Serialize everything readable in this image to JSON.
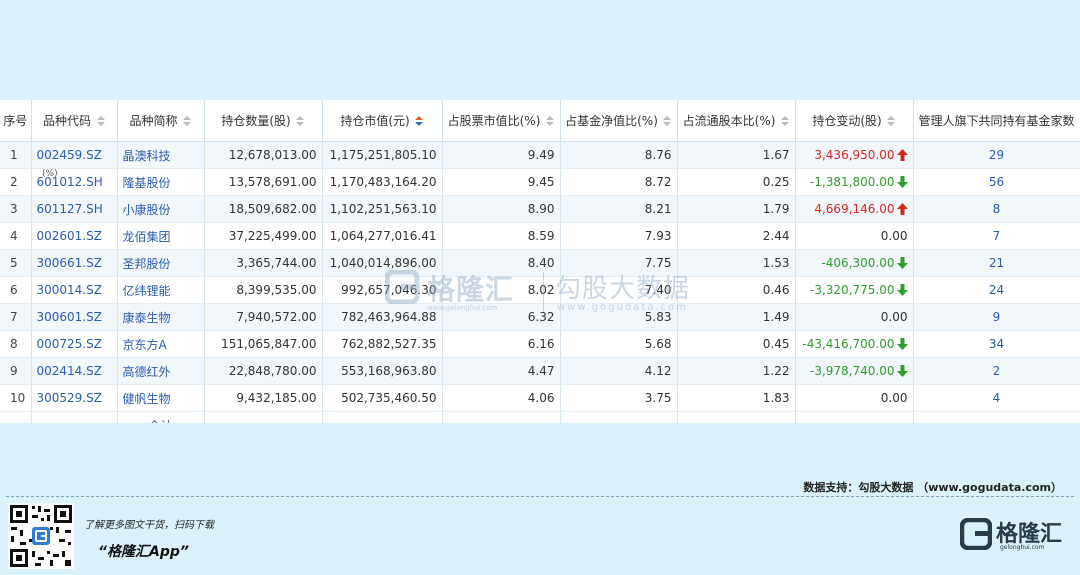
{
  "table": {
    "columns": [
      {
        "label": "序号",
        "sortable": false
      },
      {
        "label": "品种代码",
        "sortable": true
      },
      {
        "label": "品种简称",
        "sortable": true
      },
      {
        "label": "持仓数量(股)",
        "sortable": true
      },
      {
        "label": "持仓市值(元)",
        "sortable": true,
        "active": true
      },
      {
        "label": "占股票市值比(%)",
        "sortable": true
      },
      {
        "label": "占基金净值比(%)",
        "sortable": true
      },
      {
        "label": "占流通股本比(%)",
        "sortable": true
      },
      {
        "label": "持仓变动(股)",
        "sortable": true
      },
      {
        "label": "管理人旗下共同持有基金家数",
        "sortable": false
      }
    ],
    "rows": [
      {
        "idx": "1",
        "code": "002459.SZ",
        "name": "晶澳科技",
        "qty": "12,678,013.00",
        "mv": "1,175,251,805.10",
        "stock_pct": "9.49",
        "nav_pct": "8.76",
        "float_pct": "1.67",
        "change": "3,436,950.00",
        "dir": "up",
        "funds": "29"
      },
      {
        "idx": "2",
        "code": "601012.SH",
        "name": "隆基股份",
        "qty": "13,578,691.00",
        "mv": "1,170,483,164.20",
        "stock_pct": "9.45",
        "nav_pct": "8.72",
        "float_pct": "0.25",
        "change": "-1,381,800.00",
        "dir": "down",
        "funds": "56"
      },
      {
        "idx": "3",
        "code": "601127.SH",
        "name": "小康股份",
        "qty": "18,509,682.00",
        "mv": "1,102,251,563.10",
        "stock_pct": "8.90",
        "nav_pct": "8.21",
        "float_pct": "1.79",
        "change": "4,669,146.00",
        "dir": "up",
        "funds": "8"
      },
      {
        "idx": "4",
        "code": "002601.SZ",
        "name": "龙佰集团",
        "qty": "37,225,499.00",
        "mv": "1,064,277,016.41",
        "stock_pct": "8.59",
        "nav_pct": "7.93",
        "float_pct": "2.44",
        "change": "0.00",
        "dir": "none",
        "funds": "7"
      },
      {
        "idx": "5",
        "code": "300661.SZ",
        "name": "圣邦股份",
        "qty": "3,365,744.00",
        "mv": "1,040,014,896.00",
        "stock_pct": "8.40",
        "nav_pct": "7.75",
        "float_pct": "1.53",
        "change": "-406,300.00",
        "dir": "down",
        "funds": "21"
      },
      {
        "idx": "6",
        "code": "300014.SZ",
        "name": "亿纬锂能",
        "qty": "8,399,535.00",
        "mv": "992,657,046.30",
        "stock_pct": "8.02",
        "nav_pct": "7.40",
        "float_pct": "0.46",
        "change": "-3,320,775.00",
        "dir": "down",
        "funds": "24"
      },
      {
        "idx": "7",
        "code": "300601.SZ",
        "name": "康泰生物",
        "qty": "7,940,572.00",
        "mv": "782,463,964.88",
        "stock_pct": "6.32",
        "nav_pct": "5.83",
        "float_pct": "1.49",
        "change": "0.00",
        "dir": "none",
        "funds": "9"
      },
      {
        "idx": "8",
        "code": "000725.SZ",
        "name": "京东方A",
        "qty": "151,065,847.00",
        "mv": "762,882,527.35",
        "stock_pct": "6.16",
        "nav_pct": "5.68",
        "float_pct": "0.45",
        "change": "-43,416,700.00",
        "dir": "down",
        "funds": "34"
      },
      {
        "idx": "9",
        "code": "002414.SZ",
        "name": "高德红外",
        "qty": "22,848,780.00",
        "mv": "553,168,963.80",
        "stock_pct": "4.47",
        "nav_pct": "4.12",
        "float_pct": "1.22",
        "change": "-3,978,740.00",
        "dir": "down",
        "funds": "2"
      },
      {
        "idx": "10",
        "code": "300529.SZ",
        "name": "健帆生物",
        "qty": "9,432,185.00",
        "mv": "502,735,460.50",
        "stock_pct": "4.06",
        "nav_pct": "3.75",
        "float_pct": "1.83",
        "change": "0.00",
        "dir": "none",
        "funds": "4"
      }
    ],
    "total_label": "合计"
  },
  "stray_text": "(%)",
  "watermark": {
    "brand": "格隆汇",
    "brand_url": "www.gelonghui.com",
    "data_brand": "勾股大数据",
    "data_url": "www.gogudata.com"
  },
  "source_text": "数据支持：勾股大数据 （www.gogudata.com）",
  "promo": {
    "line1": "了解更多图文干货，扫码下载",
    "line2": "“格隆汇App”"
  },
  "brand": {
    "name": "格隆汇",
    "url": "gelonghui.com"
  },
  "colors": {
    "up": "#d9261c",
    "down": "#2f9e2f",
    "link": "#2a5db0",
    "background": "#d9f2fb"
  }
}
